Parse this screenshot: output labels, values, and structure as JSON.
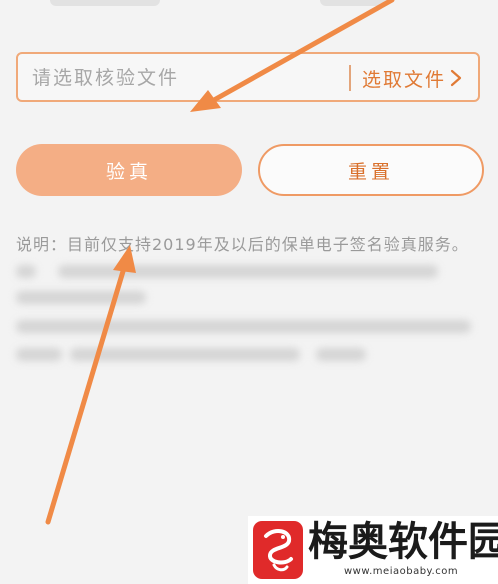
{
  "file_picker": {
    "placeholder": "请选取核验文件",
    "pick_label": "选取文件"
  },
  "actions": {
    "verify_label": "验真",
    "reset_label": "重置"
  },
  "notice": {
    "visible_text": "说明：目前仅支持2019年及以后的保单电子签名验真服务。"
  },
  "watermark": {
    "name": "梅奥软件园",
    "url": "www.meiaobaby.com"
  },
  "colors": {
    "accent": "#e07a35",
    "button_fill": "#f4ae85",
    "arrow": "#f08a46",
    "logo_red": "#e02a2a"
  },
  "icons": {
    "pick_chevron": "chevron-right-icon",
    "logo": "dragon-logo-icon"
  }
}
